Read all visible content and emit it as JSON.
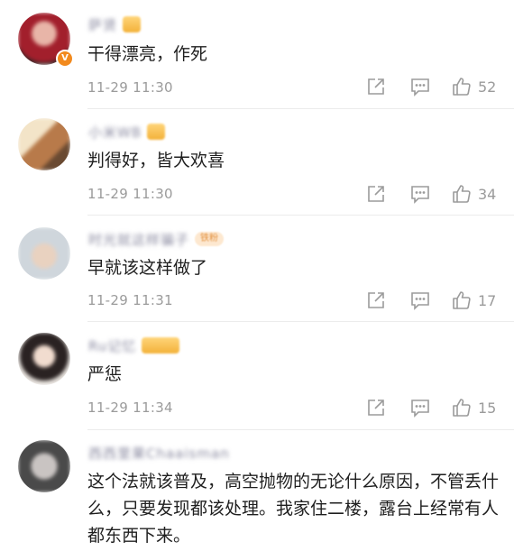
{
  "comments": [
    {
      "username": "萨贤",
      "text": "干得漂亮，作死",
      "time": "11-29 11:30",
      "likes": "52"
    },
    {
      "username": "小米WB",
      "text": "判得好，皆大欢喜",
      "time": "11-29 11:30",
      "likes": "34"
    },
    {
      "username": "时光就这样骗子",
      "fan_badge": "铁粉",
      "text": "早就该这样做了",
      "time": "11-29 11:31",
      "likes": "17"
    },
    {
      "username": "Ru记忆",
      "text": "严惩",
      "time": "11-29 11:34",
      "likes": "15"
    },
    {
      "username": "西西里果Chaaisman",
      "text": "这个法就该普及，高空抛物的无论什么原因，不管丢什么，只要发现都该处理。我家住二楼，露台上经常有人都东西下来。",
      "time": "",
      "likes": ""
    }
  ],
  "icons": {
    "share": "share-icon",
    "reply": "reply-icon",
    "like": "thumbs-up-icon"
  },
  "colors": {
    "text": "#1f1f1f",
    "meta": "#9b9b9b",
    "verified": "#f28a1e"
  }
}
